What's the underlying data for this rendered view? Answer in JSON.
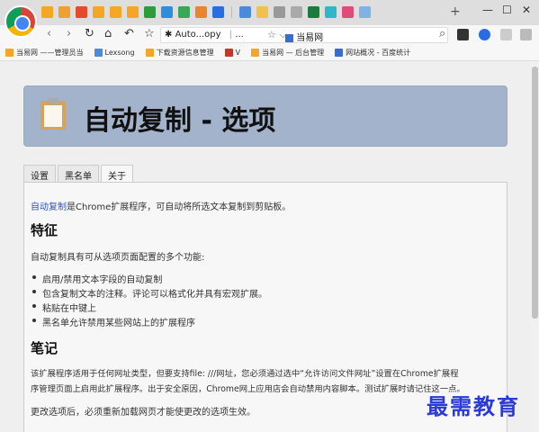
{
  "browser": {
    "new_tab_label": "+",
    "window_controls": {
      "minimize": "—",
      "maximize": "☐",
      "close": "✕"
    },
    "tab_icon_colors": [
      "#f5a623",
      "#f0a030",
      "#e24b2b",
      "#f5a623",
      "#f5a623",
      "#f5a623",
      "#2c9c3c",
      "#2d8ee0",
      "#3aa757",
      "#e9832c",
      "#2a6ce3",
      "#4a8cdb",
      "#f0c24b",
      "#999999",
      "#aaaaaa",
      "#1d7a3d",
      "#2fb6c7",
      "#e04b7b",
      "#7fb3e6"
    ],
    "nav": {
      "back": "‹",
      "forward": "›",
      "reload": "↻",
      "home": "⌂",
      "undo": "↶",
      "star": "☆"
    },
    "omnibox": {
      "tab_text": "Auto...opy",
      "separator": "|",
      "ellipsis": "...",
      "star": "☆",
      "dropdown": "⌵",
      "site_label": "当易网"
    },
    "search_icon": "⌕"
  },
  "bookmarks": [
    {
      "label": "当易网 ——管理员当",
      "color": "#f5a623"
    },
    {
      "label": "Lexsong",
      "color": "#4a8cdb"
    },
    {
      "label": "下载资源信息管理",
      "color": "#f5a623"
    },
    {
      "label": "V",
      "color": "#c0392b"
    },
    {
      "label": "当易网 — 后台管理",
      "color": "#f5a623"
    },
    {
      "label": "网站概况 - 百度统计",
      "color": "#3a6bd1"
    }
  ],
  "header": {
    "title": "自动复制 - 选项"
  },
  "tabs": [
    {
      "label": "设置",
      "active": false
    },
    {
      "label": "黑名单",
      "active": false
    },
    {
      "label": "关于",
      "active": true
    }
  ],
  "about": {
    "intro_link": "自动复制",
    "intro_rest": "是Chrome扩展程序，可自动将所选文本复制到剪贴板。",
    "features_heading": "特征",
    "features_intro": "自动复制具有可从选项页面配置的多个功能:",
    "features": [
      "启用/禁用文本字段的自动复制",
      "包含复制文本的注释。评论可以格式化并具有宏观扩展。",
      "粘贴在中键上",
      "黑名单允许禁用某些网站上的扩展程序"
    ],
    "notes_heading": "笔记",
    "notes_line1": "该扩展程序适用于任何网址类型，但要支持file: ///网址，您必须通过选中“允许访问文件网址”设置在Chrome扩展程",
    "notes_line2": "序管理页面上启用此扩展程序。出于安全原因，Chrome网上应用店会自动禁用内容脚本。测试扩展时请记住这一点。",
    "notes_line3": "更改选项后，必须重新加载网页才能使更改的选项生效。"
  },
  "watermark": "最需教育"
}
